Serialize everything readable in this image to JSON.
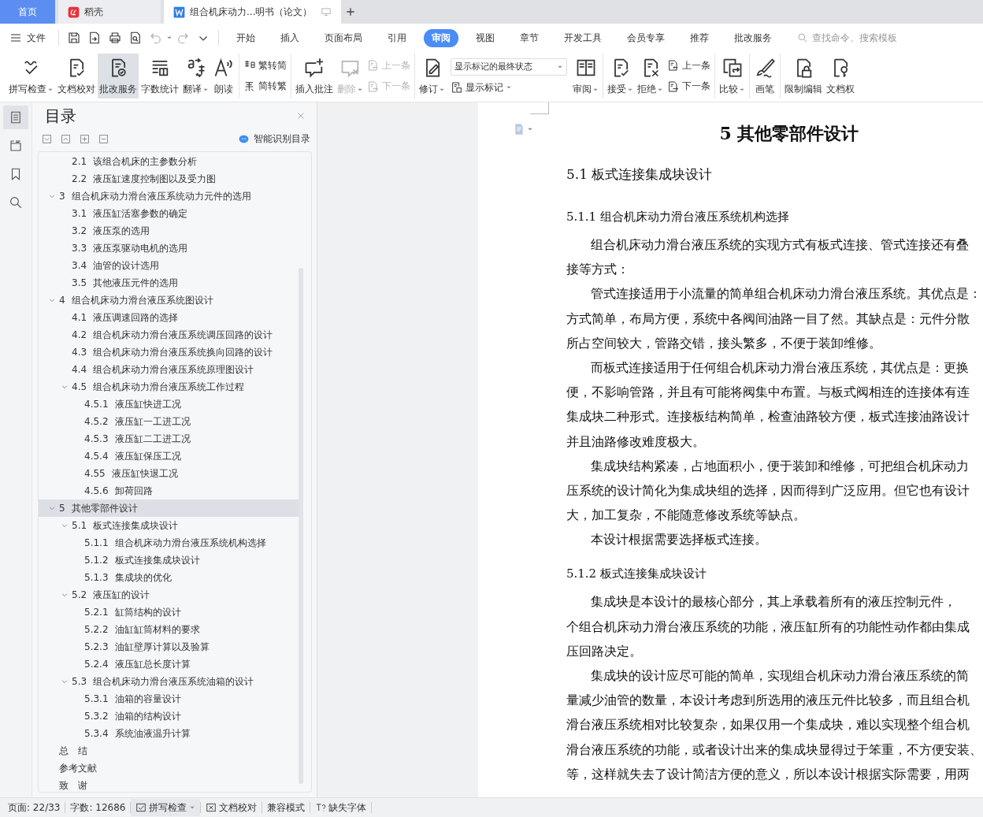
{
  "tabs": [
    {
      "label": "首页",
      "kind": "home",
      "selected": false
    },
    {
      "label": "稻壳",
      "kind": "docer",
      "selected": false
    },
    {
      "label": "组合机床动力...明书（论文）",
      "kind": "document",
      "selected": true
    }
  ],
  "quick_menu": {
    "label": "文件"
  },
  "menu_tabs": [
    {
      "label": "开始",
      "selected": false
    },
    {
      "label": "插入",
      "selected": false
    },
    {
      "label": "页面布局",
      "selected": false
    },
    {
      "label": "引用",
      "selected": false
    },
    {
      "label": "审阅",
      "selected": true
    },
    {
      "label": "视图",
      "selected": false
    },
    {
      "label": "章节",
      "selected": false
    },
    {
      "label": "开发工具",
      "selected": false
    },
    {
      "label": "会员专享",
      "selected": false
    },
    {
      "label": "推荐",
      "selected": false
    },
    {
      "label": "批改服务",
      "selected": false
    }
  ],
  "search": {
    "placeholder": "查找命令、搜索模板"
  },
  "ribbon_groups": [
    {
      "items": [
        {
          "kind": "big",
          "label": "拼写检查",
          "dropdown": true,
          "selected": false,
          "disabled": false
        },
        {
          "kind": "big",
          "label": "文档校对",
          "dropdown": false,
          "selected": false,
          "disabled": false
        },
        {
          "kind": "big",
          "label": "批改服务",
          "dropdown": false,
          "selected": true,
          "disabled": false
        },
        {
          "kind": "big",
          "label": "字数统计",
          "dropdown": false,
          "selected": false,
          "disabled": false
        },
        {
          "kind": "big",
          "label": "翻译",
          "dropdown": true,
          "selected": false,
          "disabled": false
        },
        {
          "kind": "big",
          "label": "朗读",
          "dropdown": false,
          "selected": false,
          "disabled": false
        }
      ]
    },
    {
      "items": [
        {
          "kind": "pair",
          "rows": [
            {
              "label": "繁转简",
              "disabled": false
            },
            {
              "label": "简转繁",
              "disabled": false
            }
          ]
        }
      ]
    },
    {
      "items": [
        {
          "kind": "big",
          "label": "插入批注",
          "dropdown": false,
          "selected": false,
          "disabled": false
        },
        {
          "kind": "big",
          "label": "删除",
          "dropdown": true,
          "selected": false,
          "disabled": true
        },
        {
          "kind": "pair",
          "rows": [
            {
              "label": "上一条",
              "disabled": true
            },
            {
              "label": "下一条",
              "disabled": true
            }
          ]
        }
      ]
    },
    {
      "items": [
        {
          "kind": "big",
          "label": "修订",
          "dropdown": true,
          "selected": false,
          "disabled": false
        },
        {
          "kind": "select",
          "value": "显示标记的最终状态",
          "below": {
            "label": "显示标记",
            "dropdown": true
          }
        },
        {
          "kind": "big",
          "label": "审阅",
          "dropdown": true,
          "selected": false,
          "disabled": false
        }
      ]
    },
    {
      "items": [
        {
          "kind": "big",
          "label": "接受",
          "dropdown": true,
          "selected": false,
          "disabled": false
        },
        {
          "kind": "big",
          "label": "拒绝",
          "dropdown": true,
          "selected": false,
          "disabled": false
        },
        {
          "kind": "pair",
          "rows": [
            {
              "label": "上一条",
              "disabled": false
            },
            {
              "label": "下一条",
              "disabled": false
            }
          ]
        }
      ]
    },
    {
      "items": [
        {
          "kind": "big",
          "label": "比较",
          "dropdown": true,
          "selected": false,
          "disabled": false
        }
      ]
    },
    {
      "items": [
        {
          "kind": "big",
          "label": "画笔",
          "dropdown": false,
          "selected": false,
          "disabled": false
        }
      ]
    },
    {
      "items": [
        {
          "kind": "big",
          "label": "限制编辑",
          "dropdown": false,
          "selected": false,
          "disabled": false
        },
        {
          "kind": "big",
          "label": "文档权",
          "dropdown": false,
          "selected": false,
          "disabled": false
        }
      ]
    }
  ],
  "side_rail": [
    {
      "selected": true
    },
    {
      "selected": false
    },
    {
      "selected": false
    },
    {
      "selected": false
    }
  ],
  "toc": {
    "title": "目录",
    "smart_button": "智能识别目录",
    "continued": [
      {
        "number": "2.1",
        "title": "该组合机床的主参数分析",
        "selected": false
      },
      {
        "number": "2.2",
        "title": "液压缸速度控制图以及受力图",
        "selected": false
      }
    ],
    "items": [
      {
        "number": "3",
        "title": "组合机床动力滑台液压系统动力元件的选用",
        "selected": false,
        "expanded": true,
        "children": [
          {
            "number": "3.1",
            "title": "液压缸活塞参数的确定",
            "selected": false
          },
          {
            "number": "3.2",
            "title": "液压泵的选用",
            "selected": false
          },
          {
            "number": "3.3",
            "title": "液压泵驱动电机的选用",
            "selected": false
          },
          {
            "number": "3.4",
            "title": "油管的设计选用",
            "selected": false
          },
          {
            "number": "3.5",
            "title": "其他液压元件的选用",
            "selected": false
          }
        ]
      },
      {
        "number": "4",
        "title": "组合机床动力滑台液压系统图设计",
        "selected": false,
        "expanded": true,
        "children": [
          {
            "number": "4.1",
            "title": "液压调速回路的选择",
            "selected": false
          },
          {
            "number": "4.2",
            "title": "组合机床动力滑台液压系统调压回路的设计",
            "selected": false
          },
          {
            "number": "4.3",
            "title": "组合机床动力滑台液压系统换向回路的设计",
            "selected": false
          },
          {
            "number": "4.4",
            "title": "组合机床动力滑台液压系统原理图设计",
            "selected": false
          },
          {
            "number": "4.5",
            "title": "组合机床动力滑台液压系统工作过程",
            "selected": false,
            "expanded": true,
            "children": [
              {
                "number": "4.5.1",
                "title": "液压缸快进工况",
                "selected": false
              },
              {
                "number": "4.5.2",
                "title": "液压缸一工进工况",
                "selected": false
              },
              {
                "number": "4.5.3",
                "title": "液压缸二工进工况",
                "selected": false
              },
              {
                "number": "4.5.4",
                "title": "液压缸保压工况",
                "selected": false
              },
              {
                "number": "4.55",
                "title": "液压缸快退工况",
                "selected": false
              },
              {
                "number": "4.5.6",
                "title": "卸荷回路",
                "selected": false
              }
            ]
          }
        ]
      },
      {
        "number": "5",
        "title": "其他零部件设计",
        "selected": true,
        "expanded": true,
        "children": [
          {
            "number": "5.1",
            "title": "板式连接集成块设计",
            "selected": false,
            "expanded": true,
            "children": [
              {
                "number": "5.1.1",
                "title": "组合机床动力滑台液压系统机构选择",
                "selected": false
              },
              {
                "number": "5.1.2",
                "title": "板式连接集成块设计",
                "selected": false
              },
              {
                "number": "5.1.3",
                "title": "集成块的优化",
                "selected": false
              }
            ]
          },
          {
            "number": "5.2",
            "title": "液压缸的设计",
            "selected": false,
            "expanded": true,
            "children": [
              {
                "number": "5.2.1",
                "title": "缸筒结构的设计",
                "selected": false
              },
              {
                "number": "5.2.2",
                "title": "油缸缸筒材料的要求",
                "selected": false
              },
              {
                "number": "5.2.3",
                "title": "油缸壁厚计算以及验算",
                "selected": false
              },
              {
                "number": "5.2.4",
                "title": "液压缸总长度计算",
                "selected": false
              }
            ]
          },
          {
            "number": "5.3",
            "title": "组合机床动力滑台液压系统油箱的设计",
            "selected": false,
            "expanded": true,
            "children": [
              {
                "number": "5.3.1",
                "title": "油箱的容量设计",
                "selected": false
              },
              {
                "number": "5.3.2",
                "title": "油箱的结构设计",
                "selected": false
              },
              {
                "number": "5.3.4",
                "title": "系统油液温升计算",
                "selected": false
              }
            ]
          }
        ]
      },
      {
        "title": "总　结",
        "selected": false
      },
      {
        "title": "参考文献",
        "selected": false
      },
      {
        "title": "致　谢",
        "selected": false
      }
    ]
  },
  "document": {
    "blocks": [
      {
        "kind": "chapter",
        "text": "5  其他零部件设计"
      },
      {
        "kind": "section",
        "text": "5.1  板式连接集成块设计"
      },
      {
        "kind": "subsection",
        "text": "5.1.1  组合机床动力滑台液压系统机构选择"
      },
      {
        "kind": "paragraph",
        "lines": [
          "组合机床动力滑台液压系统的实现方式有板式连接、管式连接还有叠",
          "接等方式："
        ]
      },
      {
        "kind": "paragraph",
        "lines": [
          "管式连接适用于小流量的简单组合机床动力滑台液压系统。其优点是：",
          "方式简单，布局方便，系统中各阀间油路一目了然。其缺点是：元件分散",
          "所占空间较大，管路交错，接头繁多，不便于装卸维修。"
        ]
      },
      {
        "kind": "paragraph",
        "lines": [
          "而板式连接适用于任何组合机床动力滑台液压系统，其优点是：更换",
          "便，不影响管路，并且有可能将阀集中布置。与板式阀相连的连接体有连",
          "集成块二种形式。连接板结构简单，检查油路较方便，板式连接油路设计",
          "并且油路修改难度极大。"
        ]
      },
      {
        "kind": "paragraph",
        "lines": [
          "集成块结构紧凑，占地面积小，便于装卸和维修，可把组合机床动力",
          "压系统的设计简化为集成块组的选择，因而得到广泛应用。但它也有设计",
          "大，加工复杂，不能随意修改系统等缺点。"
        ]
      },
      {
        "kind": "paragraph",
        "lines": [
          "本设计根据需要选择板式连接。"
        ]
      },
      {
        "kind": "subsection",
        "text": "5.1.2  板式连接集成块设计"
      },
      {
        "kind": "paragraph",
        "lines": [
          "集成块是本设计的最核心部分，其上承载着所有的液压控制元件，",
          "个组合机床动力滑台液压系统的功能，液压缸所有的功能性动作都由集成",
          "压回路决定。"
        ]
      },
      {
        "kind": "paragraph",
        "lines": [
          "集成块的设计应尽可能的简单，实现组合机床动力滑台液压系统的简",
          "量减少油管的数量，本设计考虑到所选用的液压元件比较多，而且组合机",
          "滑台液压系统相对比较复杂，如果仅用一个集成块，难以实现整个组合机",
          "滑台液压系统的功能，或者设计出来的集成块显得过于笨重，不方便安装、",
          "等，这样就失去了设计简洁方便的意义，所以本设计根据实际需要，用两"
        ]
      }
    ]
  },
  "status_bar": [
    {
      "kind": "text",
      "label": "页面: 22/33"
    },
    {
      "kind": "text",
      "label": "字数: 12686"
    },
    {
      "kind": "check",
      "label": "拼写检查",
      "dropdown": true
    },
    {
      "kind": "cross",
      "label": "文档校对",
      "dropdown": false
    },
    {
      "kind": "text",
      "label": "兼容模式"
    },
    {
      "kind": "font",
      "label": "缺失字体",
      "dropdown": false
    }
  ]
}
